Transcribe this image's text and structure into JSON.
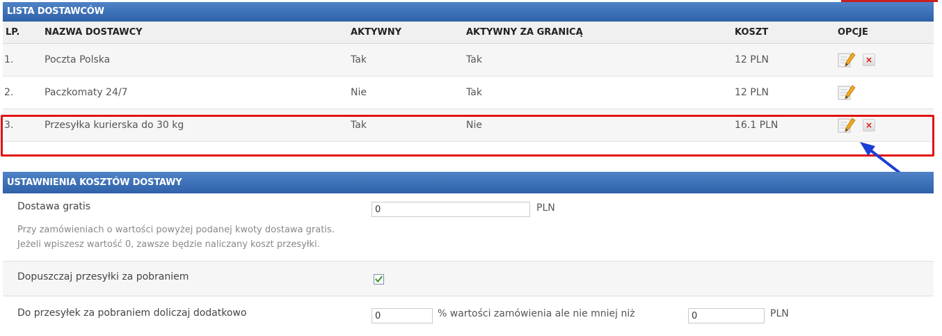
{
  "suppliers_panel": {
    "title": "LISTA DOSTAWCÓW",
    "columns": [
      "LP.",
      "NAZWA DOSTAWCY",
      "AKTYWNY",
      "AKTYWNY ZA GRANICĄ",
      "KOSZT",
      "OPCJE"
    ],
    "rows": [
      {
        "lp": "1.",
        "name": "Poczta Polska",
        "active": "Tak",
        "active_abroad": "Tak",
        "cost": "12 PLN"
      },
      {
        "lp": "2.",
        "name": "Paczkomaty 24/7",
        "active": "Nie",
        "active_abroad": "Tak",
        "cost": "12 PLN"
      },
      {
        "lp": "3.",
        "name": "Przesyłka kurierska do 30 kg",
        "active": "Tak",
        "active_abroad": "Nie",
        "cost": "16.1 PLN"
      }
    ]
  },
  "settings_panel": {
    "title": "USTAWNIENIA KOSZTÓW DOSTAWY",
    "free_shipping": {
      "label": "Dostawa gratis",
      "value": "0",
      "unit": "PLN",
      "hint_line1": "Przy zamówieniach o wartości powyżej podanej kwoty dostawa gratis.",
      "hint_line2": "Jeżeli wpiszesz wartość 0, zawsze będzie naliczany koszt przesyłki."
    },
    "cod_allowed": {
      "label": "Dopuszczaj przesyłki za pobraniem",
      "checked": true
    },
    "cod_surcharge": {
      "label": "Do przesyłek za pobraniem doliczaj dodatkowo",
      "percent_value": "0",
      "middle_text": "% wartości zamówienia ale nie mniej niż",
      "min_value": "0",
      "unit": "PLN"
    }
  },
  "colors": {
    "header_blue": "#2e61a8",
    "highlight_red": "#e21212",
    "arrow_blue": "#1a3fd6",
    "check_green": "#2a9a2a"
  },
  "icons": {
    "edit": "edit-icon",
    "delete": "delete-icon",
    "checkbox": "checkmark-icon"
  }
}
